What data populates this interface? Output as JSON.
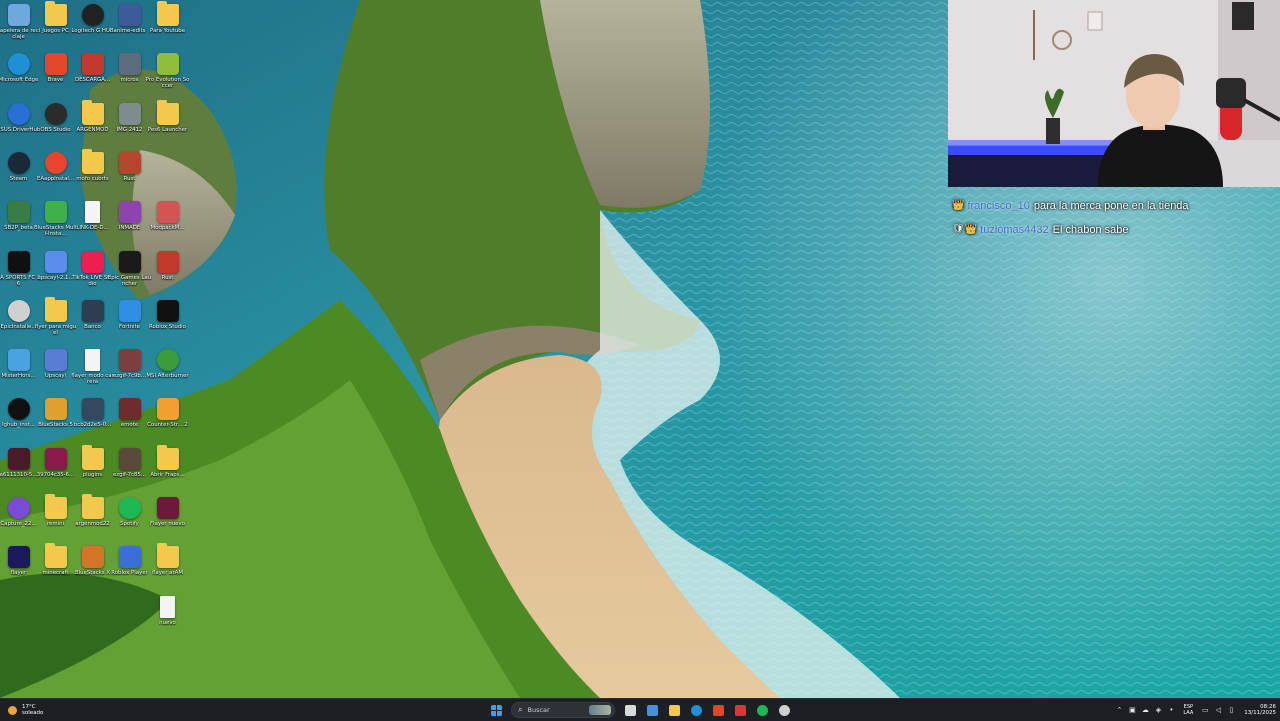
{
  "desktop": {
    "icons": [
      {
        "label": "Papelera de reciclaje",
        "icon": "recycle-bin-icon",
        "color": "#6fa8dc",
        "col": 0,
        "row": 0,
        "kind": "app"
      },
      {
        "label": "Juegos PC",
        "icon": "folder-icon",
        "color": "#f2c94c",
        "col": 1,
        "row": 0,
        "kind": "folder"
      },
      {
        "label": "Logitech G HUB",
        "icon": "g-hub-icon",
        "color": "#222222",
        "col": 2,
        "row": 0,
        "kind": "round"
      },
      {
        "label": "anime-edits",
        "icon": "image-icon",
        "color": "#3d5a99",
        "col": 3,
        "row": 0,
        "kind": "app"
      },
      {
        "label": "Para Youtube",
        "icon": "folder-icon",
        "color": "#f2c94c",
        "col": 4,
        "row": 0,
        "kind": "folder"
      },
      {
        "label": "Microsoft Edge",
        "icon": "edge-icon",
        "color": "#1f8fd6",
        "col": 0,
        "row": 1,
        "kind": "round"
      },
      {
        "label": "Brave",
        "icon": "brave-icon",
        "color": "#e2472a",
        "col": 1,
        "row": 1,
        "kind": "app"
      },
      {
        "label": "DESCARGA...",
        "icon": "pdf-icon",
        "color": "#c0392b",
        "col": 2,
        "row": 1,
        "kind": "app"
      },
      {
        "label": "micros",
        "icon": "image-icon",
        "color": "#5d6d7e",
        "col": 3,
        "row": 1,
        "kind": "app"
      },
      {
        "label": "Pro Evolution Soccer",
        "icon": "pes-icon",
        "color": "#8fbf3a",
        "col": 4,
        "row": 1,
        "kind": "app"
      },
      {
        "label": "ASUS DriverHub",
        "icon": "asus-icon",
        "color": "#2a6fd6",
        "col": 0,
        "row": 2,
        "kind": "round"
      },
      {
        "label": "OBS Studio",
        "icon": "obs-icon",
        "color": "#2b2b2b",
        "col": 1,
        "row": 2,
        "kind": "round"
      },
      {
        "label": "ARGENMOD",
        "icon": "folder-icon",
        "color": "#f2c94c",
        "col": 2,
        "row": 2,
        "kind": "folder"
      },
      {
        "label": "IMG 2412",
        "icon": "image-icon",
        "color": "#7f8c8d",
        "col": 3,
        "row": 2,
        "kind": "app"
      },
      {
        "label": "Pes6 Launcher",
        "icon": "folder-icon",
        "color": "#f2c94c",
        "col": 4,
        "row": 2,
        "kind": "folder"
      },
      {
        "label": "Steam",
        "icon": "steam-icon",
        "color": "#1b2838",
        "col": 0,
        "row": 3,
        "kind": "round"
      },
      {
        "label": "EAappInstal...",
        "icon": "ea-icon",
        "color": "#e8452c",
        "col": 1,
        "row": 3,
        "kind": "round"
      },
      {
        "label": "mofo cubrts",
        "icon": "folder-icon",
        "color": "#f2c94c",
        "col": 2,
        "row": 3,
        "kind": "folder"
      },
      {
        "label": "Rust",
        "icon": "rust-icon",
        "color": "#b5462b",
        "col": 3,
        "row": 3,
        "kind": "app"
      },
      {
        "label": "SB2P_beta",
        "icon": "app-icon",
        "color": "#3a7d44",
        "col": 0,
        "row": 4,
        "kind": "app"
      },
      {
        "label": "BlueStacks Multi-Insta...",
        "icon": "bluestacks-icon",
        "color": "#40b04a",
        "col": 1,
        "row": 4,
        "kind": "app"
      },
      {
        "label": "LINK-DE-D...",
        "icon": "file-icon",
        "color": "#f4f4f4",
        "col": 2,
        "row": 4,
        "kind": "file"
      },
      {
        "label": "INMADE",
        "icon": "image-icon",
        "color": "#8e44ad",
        "col": 3,
        "row": 4,
        "kind": "app"
      },
      {
        "label": "ModpackM...",
        "icon": "modpack-icon",
        "color": "#d35454",
        "col": 4,
        "row": 4,
        "kind": "app"
      },
      {
        "label": "EA SPORTS FC 26",
        "icon": "fc26-icon",
        "color": "#101010",
        "col": 0,
        "row": 5,
        "kind": "app"
      },
      {
        "label": "upscayl-2.1...",
        "icon": "upscayl-icon",
        "color": "#5b8def",
        "col": 1,
        "row": 5,
        "kind": "app"
      },
      {
        "label": "TikTok LIVE Studio",
        "icon": "tiktok-icon",
        "color": "#ee1d52",
        "col": 2,
        "row": 5,
        "kind": "app"
      },
      {
        "label": "Epic Games Launcher",
        "icon": "epic-icon",
        "color": "#1a1a1a",
        "col": 3,
        "row": 5,
        "kind": "app"
      },
      {
        "label": "Rust",
        "icon": "rust-icon",
        "color": "#c0392b",
        "col": 4,
        "row": 5,
        "kind": "app"
      },
      {
        "label": "EpicInstalle...",
        "icon": "installer-icon",
        "color": "#d0d0d0",
        "col": 0,
        "row": 6,
        "kind": "round"
      },
      {
        "label": "flyer para miguel",
        "icon": "folder-icon",
        "color": "#f2c94c",
        "col": 1,
        "row": 6,
        "kind": "folder"
      },
      {
        "label": "Banco",
        "icon": "image-icon",
        "color": "#2c3e50",
        "col": 2,
        "row": 6,
        "kind": "app"
      },
      {
        "label": "Fortnite",
        "icon": "fortnite-icon",
        "color": "#2f8de4",
        "col": 3,
        "row": 6,
        "kind": "app"
      },
      {
        "label": "Roblox Studio",
        "icon": "roblox-studio-icon",
        "color": "#111111",
        "col": 4,
        "row": 6,
        "kind": "app"
      },
      {
        "label": "MisterHors...",
        "icon": "app-icon",
        "color": "#4aa3df",
        "col": 0,
        "row": 7,
        "kind": "app"
      },
      {
        "label": "Upscayl",
        "icon": "upscayl-icon",
        "color": "#5b7bd5",
        "col": 1,
        "row": 7,
        "kind": "app"
      },
      {
        "label": "flayer modo carrera",
        "icon": "file-icon",
        "color": "#f4f4f4",
        "col": 2,
        "row": 7,
        "kind": "file"
      },
      {
        "label": "ezgif-7c9b...",
        "icon": "image-icon",
        "color": "#7b3f3f",
        "col": 3,
        "row": 7,
        "kind": "app"
      },
      {
        "label": "MSI Afterburner",
        "icon": "msi-icon",
        "color": "#3a9d3a",
        "col": 4,
        "row": 7,
        "kind": "round"
      },
      {
        "label": "lghub_inst...",
        "icon": "g-hub-icon",
        "color": "#111111",
        "col": 0,
        "row": 8,
        "kind": "round"
      },
      {
        "label": "BlueStacks 5",
        "icon": "bluestacks-icon",
        "color": "#e0a030",
        "col": 1,
        "row": 8,
        "kind": "app"
      },
      {
        "label": "bcb2d2e5-0...",
        "icon": "image-icon",
        "color": "#34495e",
        "col": 2,
        "row": 8,
        "kind": "app"
      },
      {
        "label": "emote",
        "icon": "image-icon",
        "color": "#6e2c2c",
        "col": 3,
        "row": 8,
        "kind": "app"
      },
      {
        "label": "Counter-Str... 2",
        "icon": "cs2-icon",
        "color": "#f0a030",
        "col": 4,
        "row": 8,
        "kind": "app"
      },
      {
        "label": "a6111310-5...",
        "icon": "image-icon",
        "color": "#4a1a2a",
        "col": 0,
        "row": 9,
        "kind": "app"
      },
      {
        "label": "39704c35-6...",
        "icon": "image-icon",
        "color": "#8a1a4a",
        "col": 1,
        "row": 9,
        "kind": "app"
      },
      {
        "label": "plugins",
        "icon": "folder-icon",
        "color": "#f2c94c",
        "col": 2,
        "row": 9,
        "kind": "folder"
      },
      {
        "label": "ezgif-7c85...",
        "icon": "image-icon",
        "color": "#5a4a3a",
        "col": 3,
        "row": 9,
        "kind": "app"
      },
      {
        "label": "Abrir Fraps...",
        "icon": "folder-icon",
        "color": "#f2c94c",
        "col": 4,
        "row": 9,
        "kind": "folder"
      },
      {
        "label": "Capture_22...",
        "icon": "capture-icon",
        "color": "#7b4ad6",
        "col": 0,
        "row": 10,
        "kind": "round"
      },
      {
        "label": "remini",
        "icon": "folder-icon",
        "color": "#f2c94c",
        "col": 1,
        "row": 10,
        "kind": "folder"
      },
      {
        "label": "argenmod22",
        "icon": "folder-icon",
        "color": "#f2c94c",
        "col": 2,
        "row": 10,
        "kind": "folder"
      },
      {
        "label": "Spotify",
        "icon": "spotify-icon",
        "color": "#1db954",
        "col": 3,
        "row": 10,
        "kind": "round"
      },
      {
        "label": "Flayer nuevo",
        "icon": "image-icon",
        "color": "#6a1a3a",
        "col": 4,
        "row": 10,
        "kind": "app"
      },
      {
        "label": "flayer",
        "icon": "after-effects-icon",
        "color": "#1a1a5a",
        "col": 0,
        "row": 11,
        "kind": "app"
      },
      {
        "label": "minecraft",
        "icon": "folder-icon",
        "color": "#f2c94c",
        "col": 1,
        "row": 11,
        "kind": "folder"
      },
      {
        "label": "BlueStacks X",
        "icon": "bluestacks-icon",
        "color": "#d4762a",
        "col": 2,
        "row": 11,
        "kind": "app"
      },
      {
        "label": "Roblox Player",
        "icon": "roblox-icon",
        "color": "#3b6fd8",
        "col": 3,
        "row": 11,
        "kind": "app"
      },
      {
        "label": "flayer arAM",
        "icon": "folder-icon",
        "color": "#f2c94c",
        "col": 4,
        "row": 11,
        "kind": "folder"
      },
      {
        "label": "nuevo",
        "icon": "file-icon",
        "color": "#f4f4f4",
        "col": 4,
        "row": 12,
        "kind": "file"
      }
    ]
  },
  "chat": {
    "messages": [
      {
        "badge": "👑",
        "user": "francisco_10",
        "text": "para la merca pone en la tienda"
      },
      {
        "badge": "🛡👑",
        "user": "tuzlomas4432",
        "text": "El chabon sabe"
      }
    ]
  },
  "taskbar": {
    "weather": {
      "temp": "17°C",
      "condition": "soleado",
      "icon": "sun-icon",
      "color": "#f2a23a"
    },
    "search": {
      "placeholder": "Buscar"
    },
    "apps": [
      {
        "name": "task-view-icon",
        "color": "#d9d9d9"
      },
      {
        "name": "microsoft-store-icon",
        "color": "#4a90d9"
      },
      {
        "name": "file-explorer-icon",
        "color": "#f2c94c"
      },
      {
        "name": "edge-icon",
        "color": "#1f8fd6"
      },
      {
        "name": "brave-icon",
        "color": "#e2472a"
      },
      {
        "name": "app-red-icon",
        "color": "#d9363e"
      },
      {
        "name": "spotify-icon",
        "color": "#1db954"
      },
      {
        "name": "obs-icon",
        "color": "#cfcfcf"
      }
    ],
    "language": {
      "primary": "ESP",
      "secondary": "LAA"
    },
    "clock": {
      "time": "08:26",
      "date": "13/11/2025"
    }
  }
}
